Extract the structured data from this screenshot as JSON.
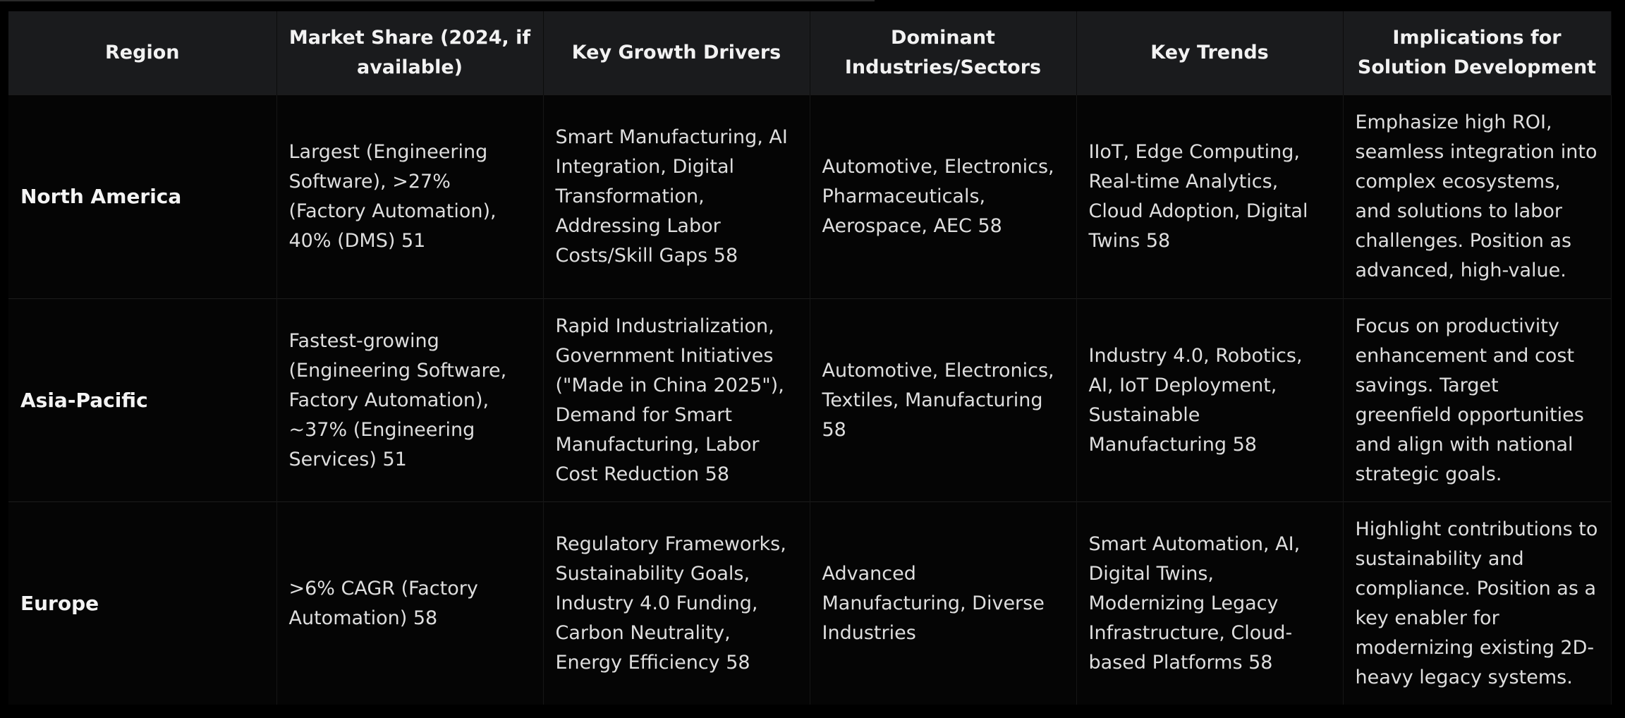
{
  "table": {
    "headers": [
      "Region",
      "Market Share (2024, if available)",
      "Key Growth Drivers",
      "Dominant Industries/Sectors",
      "Key Trends",
      "Implications for Solution Development"
    ],
    "rows": [
      {
        "region": "North America",
        "market_share": "Largest (Engineering Software), >27% (Factory Automation), 40% (DMS) 51",
        "growth_drivers": "Smart Manufacturing, AI Integration, Digital Transformation, Addressing Labor Costs/Skill Gaps 58",
        "industries": "Automotive, Electronics, Pharmaceuticals, Aerospace, AEC 58",
        "trends": "IIoT, Edge Computing, Real-time Analytics, Cloud Adoption, Digital Twins 58",
        "implications": "Emphasize high ROI, seamless integration into complex ecosystems, and solutions to labor challenges. Position as advanced, high-value."
      },
      {
        "region": "Asia-Pacific",
        "market_share": "Fastest-growing (Engineering Software, Factory Automation), ~37% (Engineering Services) 51",
        "growth_drivers": "Rapid Industrialization, Government Initiatives (\"Made in China 2025\"), Demand for Smart Manufacturing, Labor Cost Reduction 58",
        "industries": "Automotive, Electronics, Textiles, Manufacturing 58",
        "trends": "Industry 4.0, Robotics, AI, IoT Deployment, Sustainable Manufacturing 58",
        "implications": "Focus on productivity enhancement and cost savings. Target greenfield opportunities and align with national strategic goals."
      },
      {
        "region": "Europe",
        "market_share": ">6% CAGR (Factory Automation) 58",
        "growth_drivers": "Regulatory Frameworks, Sustainability Goals, Industry 4.0 Funding, Carbon Neutrality, Energy Efficiency 58",
        "industries": "Advanced Manufacturing, Diverse Industries",
        "trends": "Smart Automation, AI, Digital Twins, Modernizing Legacy Infrastructure, Cloud-based Platforms 58",
        "implications": "Highlight contributions to sustainability and compliance. Position as a key enabler for modernizing existing 2D-heavy legacy systems."
      }
    ]
  }
}
